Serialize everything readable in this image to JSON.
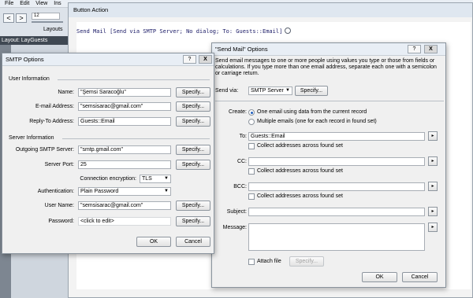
{
  "menubar": {
    "items": [
      "File",
      "Edit",
      "View",
      "Ins"
    ]
  },
  "toolbar": {
    "back": "<",
    "forward": ">",
    "record_number": "12",
    "layouts_label": "Layouts"
  },
  "layout_bar": {
    "label": "Layout: LayGuests"
  },
  "button_action": {
    "title": "Button Action",
    "script_step": "Send Mail [Send via SMTP Server; No dialog; To: Guests::Email]"
  },
  "smtp": {
    "title": "SMTP Options",
    "help": "?",
    "close": "X",
    "user_info_header": "User Information",
    "name_label": "Name:",
    "name_value": "\"Şemsi Saracoğlu\"",
    "email_label": "E-mail Address:",
    "email_value": "\"semsisarac@gmail.com\"",
    "reply_label": "Reply-To Address:",
    "reply_value": "Guests::Email",
    "server_info_header": "Server Information",
    "smtp_server_label": "Outgoing SMTP Server:",
    "smtp_server_value": "\"smtp.gmail.com\"",
    "port_label": "Server Port:",
    "port_value": "25",
    "encryption_label": "Connection encryption:",
    "encryption_value": "TLS",
    "auth_label": "Authentication:",
    "auth_value": "Plain Password",
    "user_label": "User Name:",
    "user_value": "\"semsisarac@gmail.com\"",
    "password_label": "Password:",
    "password_value": "<click to edit>",
    "specify": "Specify...",
    "ok": "OK",
    "cancel": "Cancel"
  },
  "sendmail": {
    "title": "\"Send Mail\" Options",
    "help": "?",
    "close": "X",
    "description": "Send email messages to one or more people using values you type or those from fields or calculations. If you type more than one email address, separate each one with a semicolon or carriage return.",
    "send_via_label": "Send via:",
    "send_via_value": "SMTP Server",
    "specify": "Specify...",
    "create_label": "Create:",
    "create_one": "One email using data from the current record",
    "create_multiple": "Multiple emails (one for each record in found set)",
    "to_label": "To:",
    "to_value": "Guests::Email",
    "collect_label": "Collect addresses across found set",
    "cc_label": "CC:",
    "bcc_label": "BCC:",
    "subject_label": "Subject:",
    "message_label": "Message:",
    "attach_label": "Attach file",
    "arrow": "▸",
    "ok": "OK",
    "cancel": "Cancel"
  }
}
